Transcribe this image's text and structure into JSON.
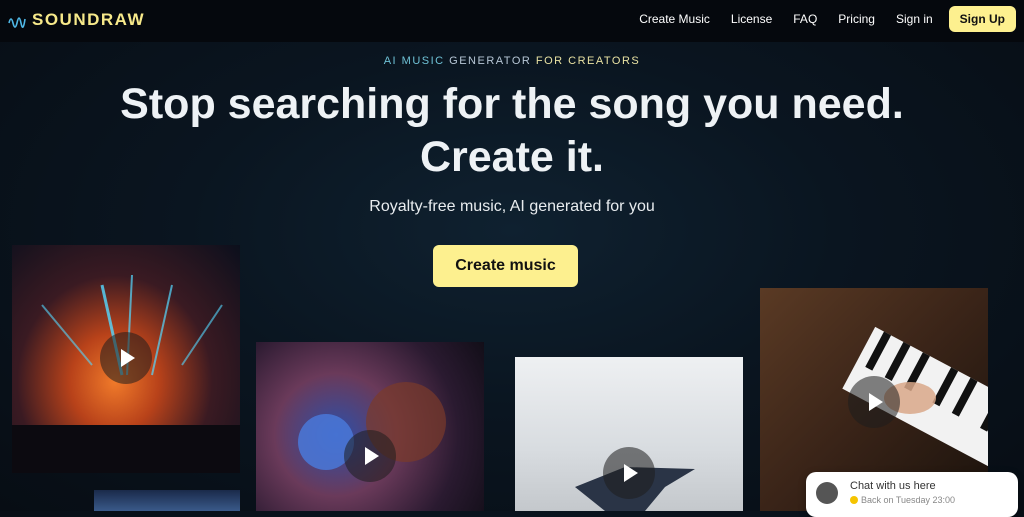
{
  "nav": {
    "logo_text": "SOUNDRAW",
    "links": [
      "Create Music",
      "License",
      "FAQ",
      "Pricing",
      "Sign in"
    ],
    "signup_label": "Sign Up"
  },
  "hero": {
    "eyebrow": {
      "part1": "AI MUSIC",
      "part2": " GENERATOR ",
      "part3": "FOR CREATORS"
    },
    "headline_line1": "Stop searching for the song you need.",
    "headline_line2": "Create it.",
    "subline": "Royalty-free music, AI generated for you",
    "cta_label": "Create music"
  },
  "chat": {
    "title": "Chat with us here",
    "status": "Back on Tuesday 23:00"
  },
  "colors": {
    "accent": "#fdf08f",
    "background": "#0a1520"
  }
}
